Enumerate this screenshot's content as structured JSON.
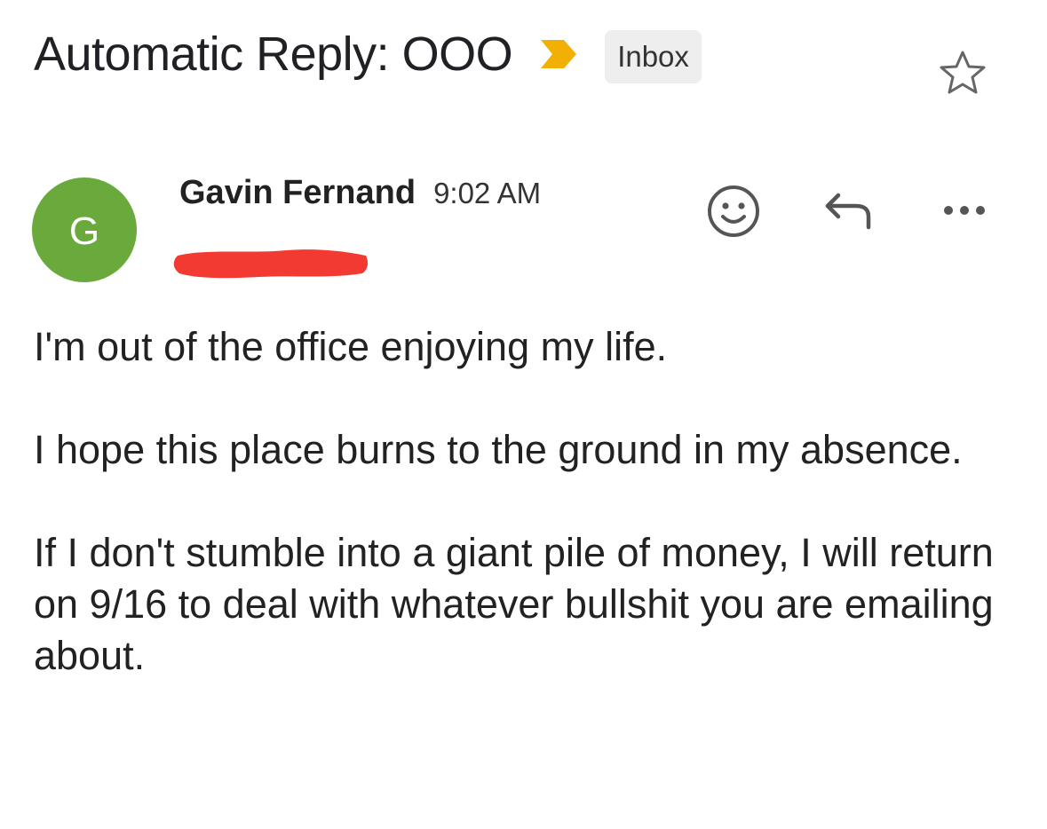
{
  "email": {
    "subject": "Automatic Reply: OOO",
    "label": "Inbox",
    "sender": {
      "avatar_initial": "G",
      "name": "Gavin Fernand",
      "time": "9:02 AM"
    },
    "body": [
      "I'm out of the office enjoying my life.",
      "I hope this place burns to the ground in my absence.",
      "If I don't stumble into a giant pile of money, I will return on 9/16 to deal with whatever bullshit you are emailing about."
    ]
  },
  "icons": {
    "importance": "importance-marker-icon",
    "star": "star-icon",
    "emoji": "smiley-icon",
    "reply": "reply-icon",
    "more": "more-options-icon"
  },
  "colors": {
    "avatar": "#6aaa3c",
    "importance": "#f2b005",
    "redaction": "#f23a33",
    "chip_bg": "#eeeeee"
  }
}
